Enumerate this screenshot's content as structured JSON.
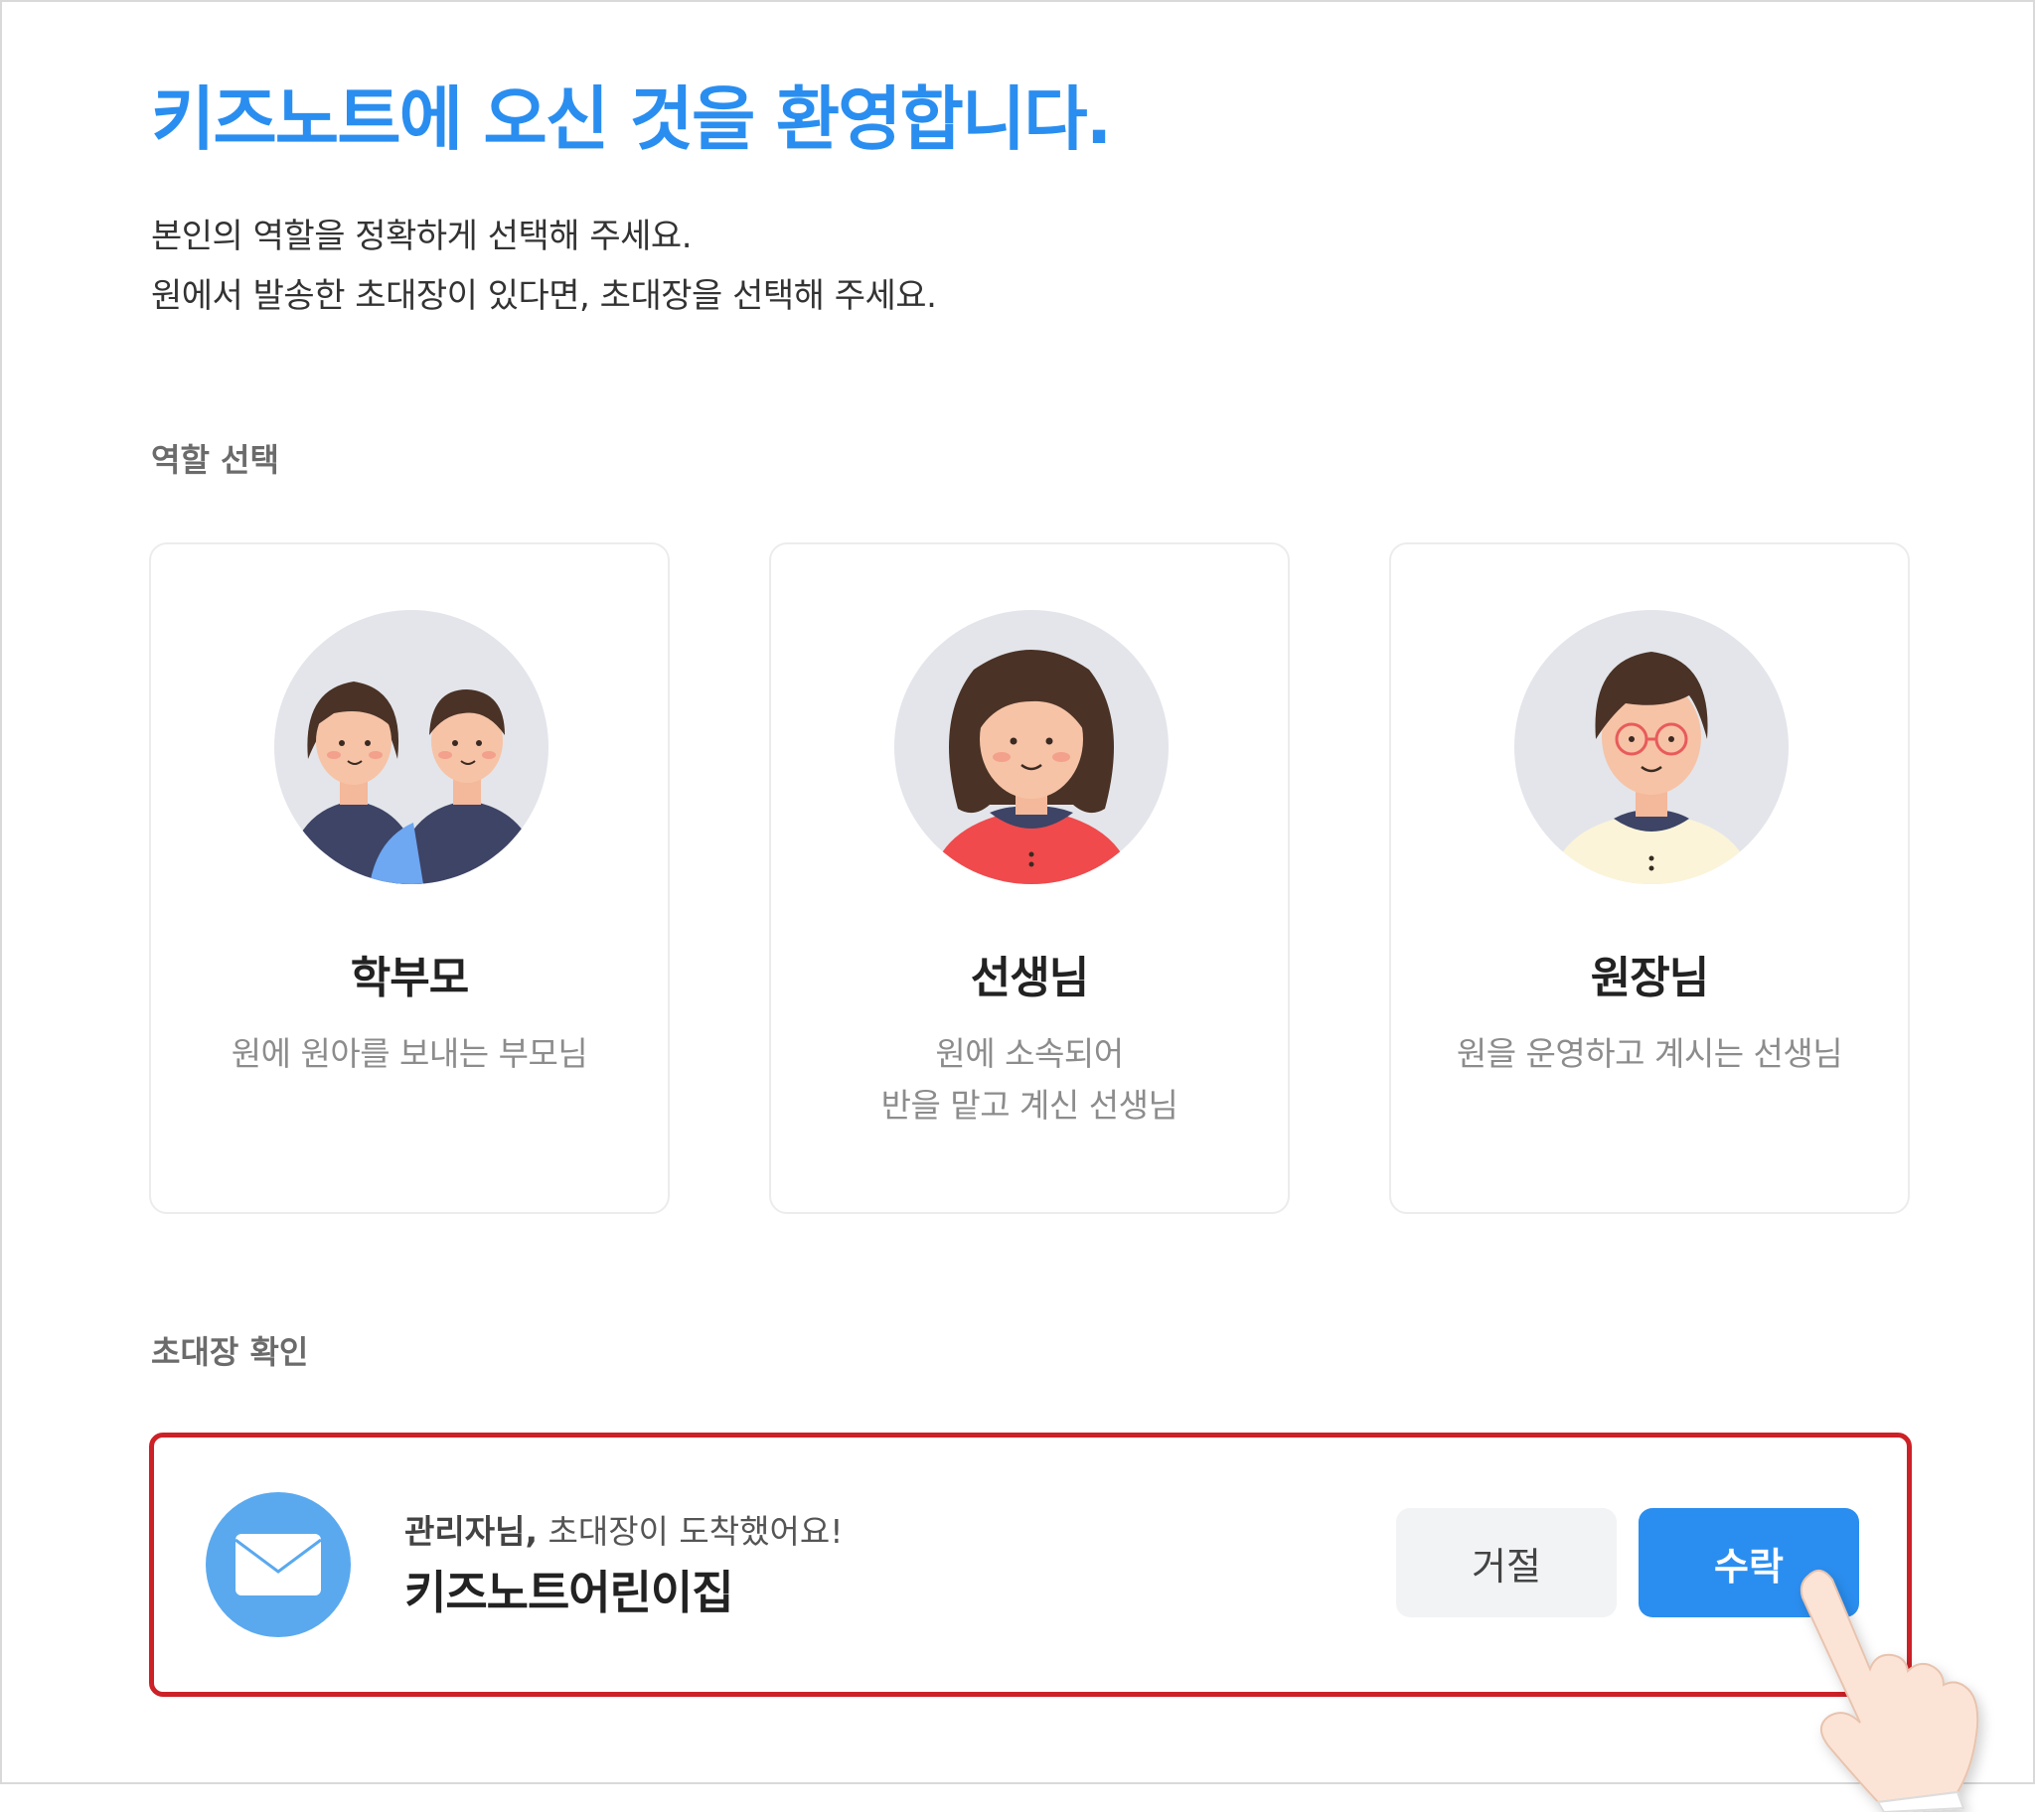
{
  "header": {
    "title": "키즈노트에 오신 것을 환영합니다.",
    "subtitle_line1": "본인의 역할을 정확하게 선택해 주세요.",
    "subtitle_line2": "원에서 발송한 초대장이 있다면, 초대장을 선택해 주세요."
  },
  "role_section": {
    "label": "역할 선택",
    "roles": [
      {
        "name": "학부모",
        "desc_line1": "원에 원아를 보내는 부모님",
        "desc_line2": ""
      },
      {
        "name": "선생님",
        "desc_line1": "원에 소속되어",
        "desc_line2": "반을 맡고 계신 선생님"
      },
      {
        "name": "원장님",
        "desc_line1": "원을 운영하고 계시는 선생님",
        "desc_line2": ""
      }
    ]
  },
  "invite_section": {
    "label": "초대장 확인",
    "recipient": "관리자님,",
    "message": " 초대장이 도착했어요!",
    "sender_name": "키즈노트어린이집",
    "reject_label": "거절",
    "accept_label": "수락"
  },
  "colors": {
    "accent": "#2a8ef0",
    "highlight_border": "#cc2127",
    "mail_icon_bg": "#5aa9ef"
  },
  "icons": [
    "parents-avatar-icon",
    "teacher-avatar-icon",
    "director-avatar-icon",
    "envelope-icon",
    "pointing-hand-icon"
  ]
}
